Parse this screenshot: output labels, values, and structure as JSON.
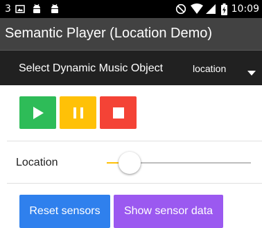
{
  "status_bar": {
    "notification_count": "3",
    "time": "10:09",
    "left_icons": [
      "image-notification-icon",
      "android-icon",
      "android-icon"
    ],
    "right_icons": [
      "do-not-disturb-icon",
      "wifi-icon",
      "cell-signal-icon",
      "battery-charging-icon"
    ]
  },
  "app_bar": {
    "title": "Semantic Player (Location Demo)"
  },
  "selector": {
    "label": "Select Dynamic Music Object",
    "selected": "location"
  },
  "player": {
    "buttons": [
      {
        "name": "play-button",
        "icon": "play-icon",
        "color": "#2ebc58"
      },
      {
        "name": "pause-button",
        "icon": "pause-icon",
        "color": "#ffc107"
      },
      {
        "name": "stop-button",
        "icon": "stop-icon",
        "color": "#f44336"
      }
    ]
  },
  "location": {
    "label": "Location",
    "slider_value": 0.16,
    "accent": "#ffc107"
  },
  "actions": {
    "reset_label": "Reset sensors",
    "reset_color": "#2f80ed",
    "show_label": "Show sensor data",
    "show_color": "#9b59f0"
  }
}
